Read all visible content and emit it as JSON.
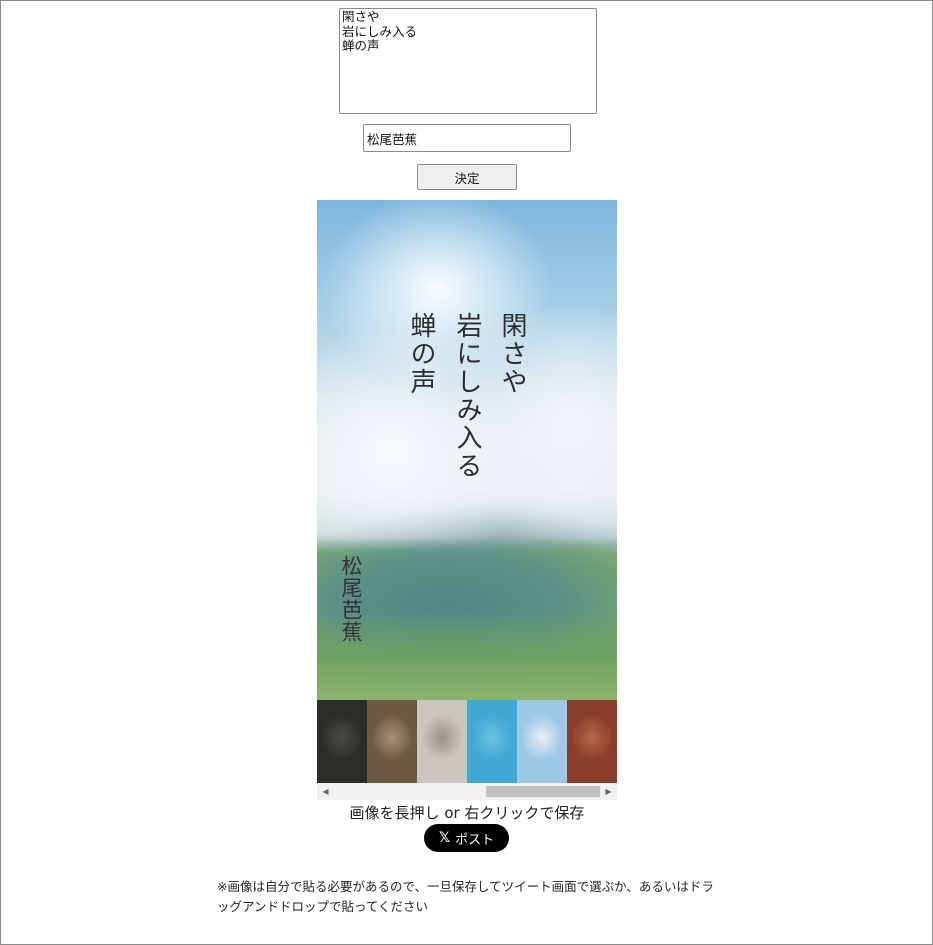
{
  "form": {
    "poem_text": "閑さや\n岩にしみ入る\n蝉の声",
    "author_value": "松尾芭蕉",
    "submit_label": "決定"
  },
  "preview": {
    "lines": [
      "閑さや",
      "岩にしみ入る",
      "蝉の声"
    ],
    "author": "松尾芭蕉"
  },
  "backgrounds": [
    {
      "name": "dark-stone",
      "colors": [
        "#2b2d29",
        "#4a4c46",
        "#1f201d"
      ]
    },
    {
      "name": "brown-blur",
      "colors": [
        "#6e5a44",
        "#a58f79",
        "#4e3f30"
      ]
    },
    {
      "name": "grey-path",
      "colors": [
        "#c9c7bf",
        "#97928b",
        "#8f9b74"
      ]
    },
    {
      "name": "sea",
      "colors": [
        "#3fa8d4",
        "#69c2de",
        "#2b8fb8"
      ]
    },
    {
      "name": "sky-hills",
      "colors": [
        "#9cc8e6",
        "#e8eef2",
        "#5b8f6c"
      ]
    },
    {
      "name": "rust",
      "colors": [
        "#8b3f2b",
        "#b5664a",
        "#6f3527"
      ]
    }
  ],
  "save_hint": "画像を長押し or 右クリックで保存",
  "post_button": {
    "icon": "x-logo-icon",
    "label": "ポスト"
  },
  "note": "※画像は自分で貼る必要があるので、一旦保存してツイート画面で選ぶか、あるいはドラッグアンドドロップで貼ってください"
}
